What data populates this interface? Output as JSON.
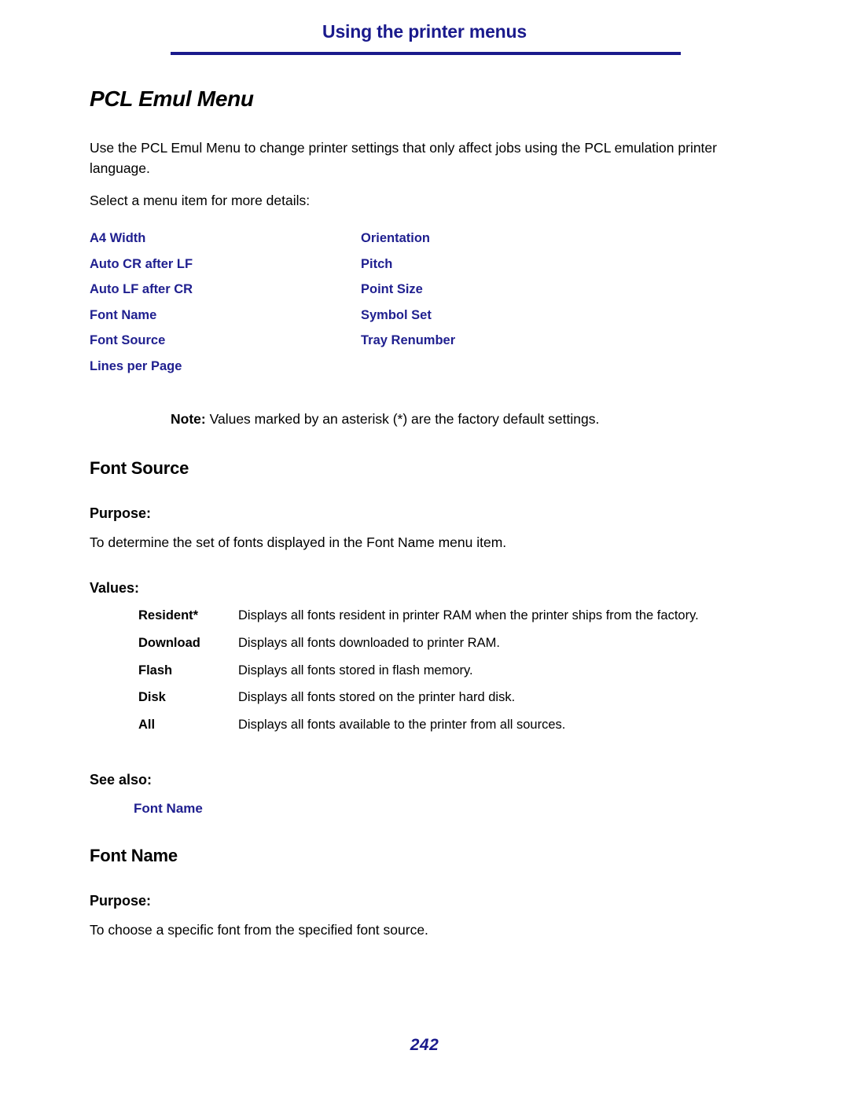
{
  "header": {
    "title": "Using the printer menus",
    "rule_color": "#1a1a8c"
  },
  "document": {
    "title": "PCL Emul Menu",
    "intro": "Use the PCL Emul Menu to change printer settings that only affect jobs using the PCL emulation printer language.",
    "select_prompt": "Select a menu item for more details:"
  },
  "menu_links": {
    "left_column": [
      {
        "label": "A4 Width"
      },
      {
        "label": "Auto CR after LF"
      },
      {
        "label": "Auto LF after CR"
      },
      {
        "label": "Font Name"
      },
      {
        "label": "Font Source"
      },
      {
        "label": "Lines per Page"
      }
    ],
    "right_column": [
      {
        "label": "Orientation"
      },
      {
        "label": "Pitch"
      },
      {
        "label": "Point Size"
      },
      {
        "label": "Symbol Set"
      },
      {
        "label": "Tray Renumber"
      }
    ],
    "link_color": "#1f1f8f"
  },
  "note": {
    "label": "Note:",
    "text": "Values marked by an asterisk (*) are the factory default settings."
  },
  "sections": [
    {
      "heading": "Font Source",
      "purpose_label": "Purpose:",
      "purpose_text": "To determine the set of fonts displayed in the Font Name menu item.",
      "values_label": "Values:",
      "values": [
        {
          "name": "Resident*",
          "description": "Displays all fonts resident in printer RAM when the printer ships from the factory."
        },
        {
          "name": "Download",
          "description": "Displays all fonts downloaded to printer RAM."
        },
        {
          "name": "Flash",
          "description": "Displays all fonts stored in flash memory."
        },
        {
          "name": "Disk",
          "description": "Displays all fonts stored on the printer hard disk."
        },
        {
          "name": "All",
          "description": "Displays all fonts available to the printer from all sources."
        }
      ],
      "see_also_label": "See also:",
      "see_also_link": "Font Name"
    },
    {
      "heading": "Font Name",
      "purpose_label": "Purpose:",
      "purpose_text": "To choose a specific font from the specified font source."
    }
  ],
  "footer": {
    "page_number": "242"
  }
}
